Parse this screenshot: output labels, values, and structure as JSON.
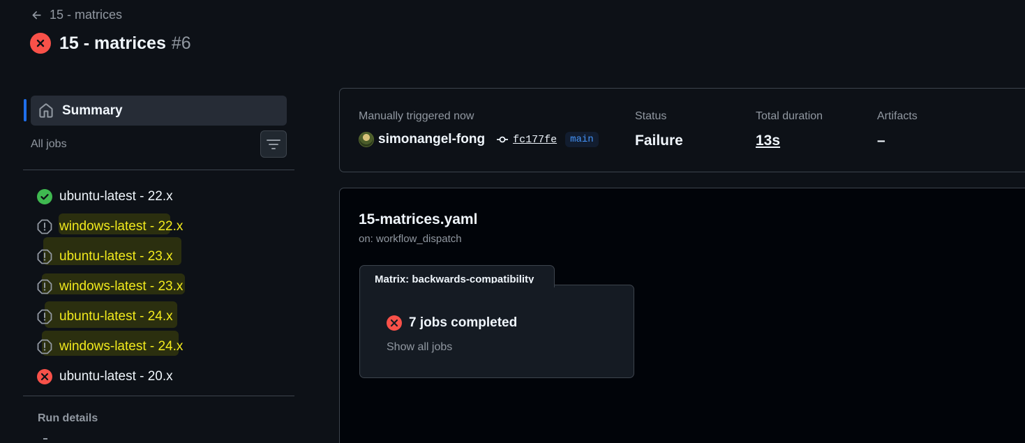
{
  "header": {
    "back_label": "15 - matrices",
    "title": "15 - matrices",
    "run_number": "#6",
    "status_icon": "x-circle-fill-icon"
  },
  "colors": {
    "failure": "#f85149",
    "success": "#3fb950",
    "warning": "#d29922",
    "accent": "#1f6feb",
    "highlight_text": "#f2ea1d"
  },
  "sidebar": {
    "summary_label": "Summary",
    "all_jobs_label": "All jobs",
    "jobs": [
      {
        "name": "ubuntu-latest - 22.x",
        "status": "success",
        "icon": "check-circle-fill-icon"
      },
      {
        "name": "windows-latest - 22.x",
        "status": "cancelled",
        "icon": "alert-octagon-icon"
      },
      {
        "name": "ubuntu-latest - 23.x",
        "status": "cancelled",
        "icon": "alert-octagon-icon"
      },
      {
        "name": "windows-latest - 23.x",
        "status": "cancelled",
        "icon": "alert-octagon-icon"
      },
      {
        "name": "ubuntu-latest - 24.x",
        "status": "cancelled",
        "icon": "alert-octagon-icon"
      },
      {
        "name": "windows-latest - 24.x",
        "status": "cancelled",
        "icon": "alert-octagon-icon"
      },
      {
        "name": "ubuntu-latest - 20.x",
        "status": "failure",
        "icon": "x-circle-fill-icon"
      }
    ],
    "run_details_label": "Run details"
  },
  "summary": {
    "trigger_label": "Manually triggered now",
    "actor": "simonangel-fong",
    "commit": "fc177fe",
    "branch": "main",
    "status_label": "Status",
    "status_value": "Failure",
    "duration_label": "Total duration",
    "duration_value": "13s",
    "artifacts_label": "Artifacts",
    "artifacts_value": "–"
  },
  "workflow": {
    "file": "15-matrices.yaml",
    "trigger": "on: workflow_dispatch",
    "matrix_title": "Matrix: backwards-compatibility",
    "jobs_completed": "7 jobs completed",
    "show_all": "Show all jobs"
  }
}
